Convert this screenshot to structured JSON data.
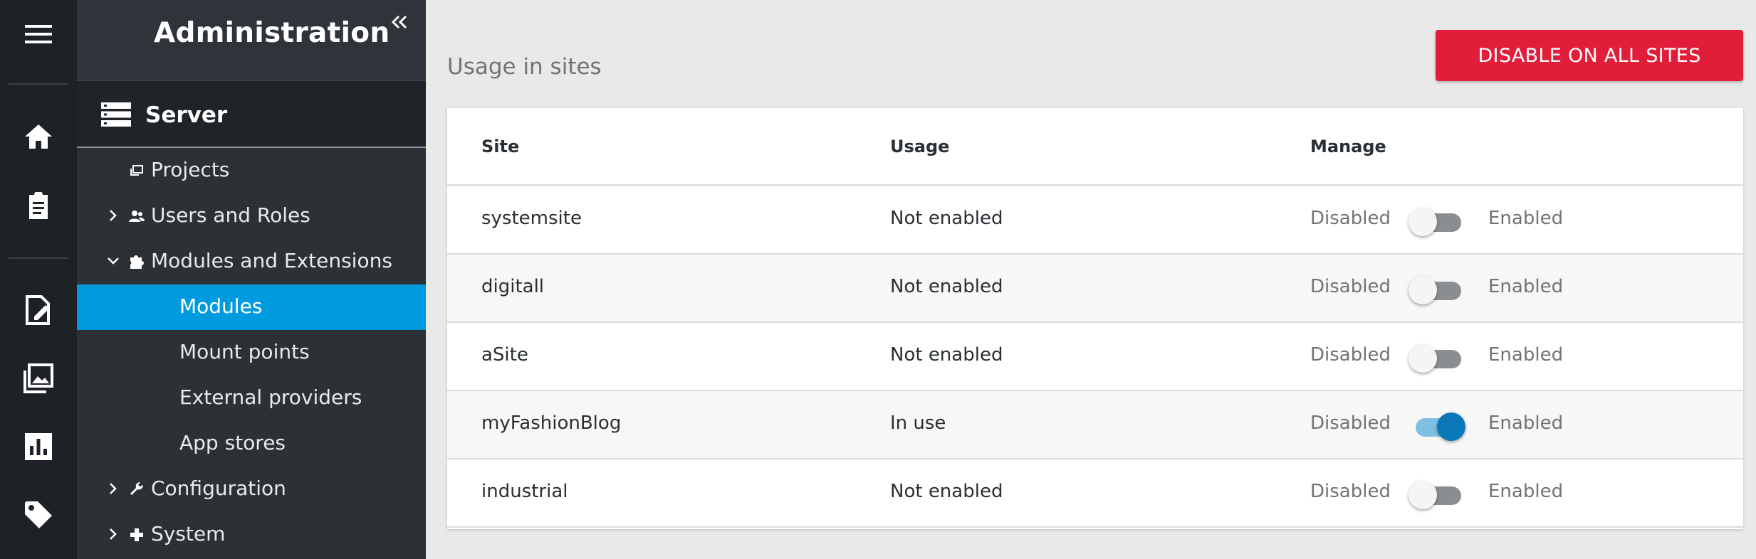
{
  "rail": {
    "icons": [
      "menu-icon",
      "home-icon",
      "clipboard-icon",
      "content-edit-icon",
      "images-icon",
      "bar-chart-icon",
      "tag-icon"
    ]
  },
  "sidebar": {
    "title": "Administration",
    "server_label": "Server",
    "items": [
      {
        "label": "Projects"
      },
      {
        "label": "Users and Roles"
      },
      {
        "label": "Modules and Extensions"
      },
      {
        "label": "Modules"
      },
      {
        "label": "Mount points"
      },
      {
        "label": "External providers"
      },
      {
        "label": "App stores"
      },
      {
        "label": "Configuration"
      },
      {
        "label": "System"
      }
    ]
  },
  "main": {
    "section_title": "Usage in sites",
    "disable_button": "DISABLE ON ALL SITES",
    "table": {
      "headers": {
        "site": "Site",
        "usage": "Usage",
        "manage": "Manage"
      },
      "disabled_label": "Disabled",
      "enabled_label": "Enabled",
      "rows": [
        {
          "site": "systemsite",
          "usage": "Not enabled",
          "enabled": false
        },
        {
          "site": "digitall",
          "usage": "Not enabled",
          "enabled": false
        },
        {
          "site": "aSite",
          "usage": "Not enabled",
          "enabled": false
        },
        {
          "site": "myFashionBlog",
          "usage": "In use",
          "enabled": true
        },
        {
          "site": "industrial",
          "usage": "Not enabled",
          "enabled": false
        }
      ]
    }
  },
  "colors": {
    "accent": "#009bdf",
    "danger": "#e11d3a",
    "toggle_on": "#0a78b8",
    "sidebar_bg": "#2c3136",
    "rail_bg": "#1e2226"
  }
}
